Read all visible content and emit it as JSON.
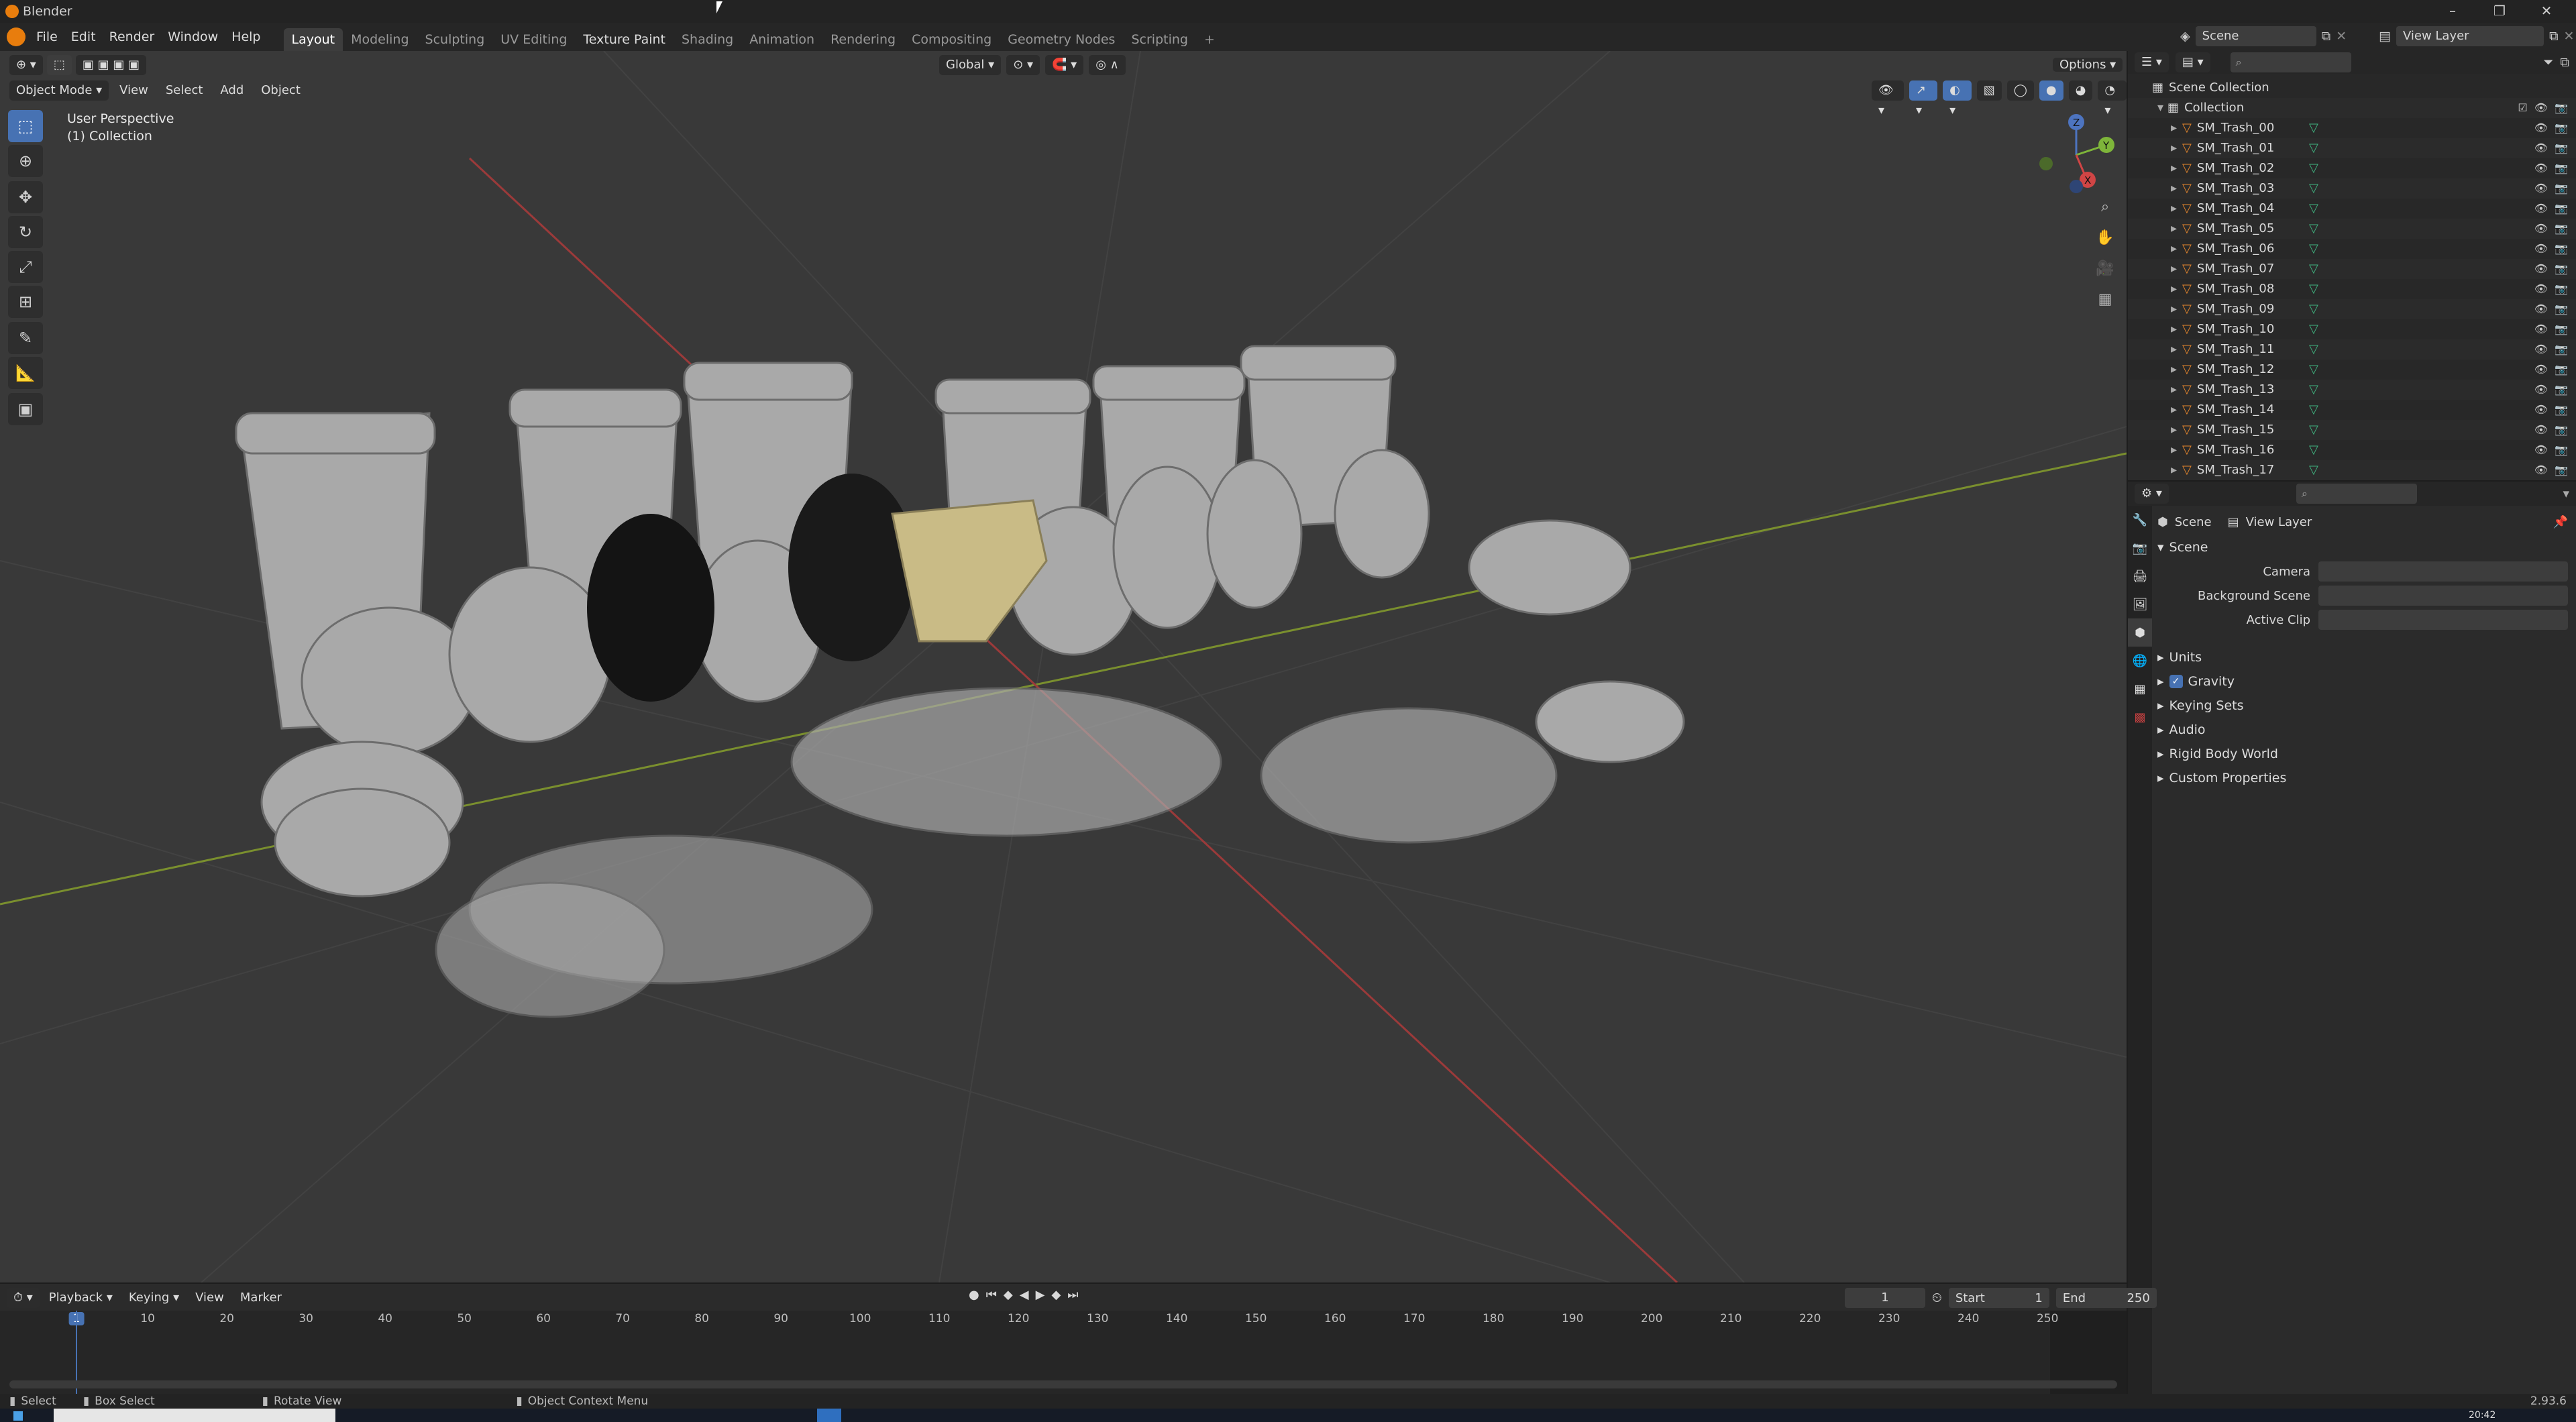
{
  "window": {
    "title": "Blender"
  },
  "menu": [
    "File",
    "Edit",
    "Render",
    "Window",
    "Help"
  ],
  "workspaces": [
    "Layout",
    "Modeling",
    "Sculpting",
    "UV Editing",
    "Texture Paint",
    "Shading",
    "Animation",
    "Rendering",
    "Compositing",
    "Geometry Nodes",
    "Scripting"
  ],
  "active_workspace": "Layout",
  "scene_selector": {
    "scene": "Scene",
    "view_layer": "View Layer"
  },
  "viewport": {
    "transform_orientation": "Global",
    "options_label": "Options",
    "mode": "Object Mode",
    "header_menus": [
      "View",
      "Select",
      "Add",
      "Object"
    ],
    "overlay_line1": "User Perspective",
    "overlay_line2": "(1) Collection",
    "gizmo": {
      "x": "X",
      "y": "Y",
      "z": "Z"
    }
  },
  "outliner": {
    "root": "Scene Collection",
    "collection": "Collection",
    "items": [
      "SM_Trash_00",
      "SM_Trash_01",
      "SM_Trash_02",
      "SM_Trash_03",
      "SM_Trash_04",
      "SM_Trash_05",
      "SM_Trash_06",
      "SM_Trash_07",
      "SM_Trash_08",
      "SM_Trash_09",
      "SM_Trash_10",
      "SM_Trash_11",
      "SM_Trash_12",
      "SM_Trash_13",
      "SM_Trash_14",
      "SM_Trash_15",
      "SM_Trash_16",
      "SM_Trash_17"
    ]
  },
  "properties": {
    "breadcrumb": {
      "scene": "Scene",
      "view_layer": "View Layer"
    },
    "scene_panel": "Scene",
    "fields": {
      "camera": "Camera",
      "background_scene": "Background Scene",
      "active_clip": "Active Clip"
    },
    "subpanels": [
      "Units",
      "Gravity",
      "Keying Sets",
      "Audio",
      "Rigid Body World",
      "Custom Properties"
    ],
    "gravity_checked": true
  },
  "timeline": {
    "menus": [
      "Playback",
      "Keying",
      "View",
      "Marker"
    ],
    "current_frame": "1",
    "start_label": "Start",
    "start": "1",
    "end_label": "End",
    "end": "250",
    "ruler": [
      "1",
      "10",
      "20",
      "30",
      "40",
      "50",
      "60",
      "70",
      "80",
      "90",
      "100",
      "110",
      "120",
      "130",
      "140",
      "150",
      "160",
      "170",
      "180",
      "190",
      "200",
      "210",
      "220",
      "230",
      "240",
      "250"
    ]
  },
  "statusbar": {
    "select": "Select",
    "box_select": "Box Select",
    "rotate_view": "Rotate View",
    "context_menu": "Object Context Menu",
    "version": "2.93.6"
  },
  "taskbar": {
    "clock": "20:42"
  },
  "colors": {
    "accent": "#4772b3",
    "brand": "#e87d0d",
    "mesh_icon": "#e8872c",
    "data_icon": "#3fb37f",
    "viewport_bg": "#393939",
    "axis_x": "#9b3a3a",
    "axis_y": "#7a8f2e"
  }
}
